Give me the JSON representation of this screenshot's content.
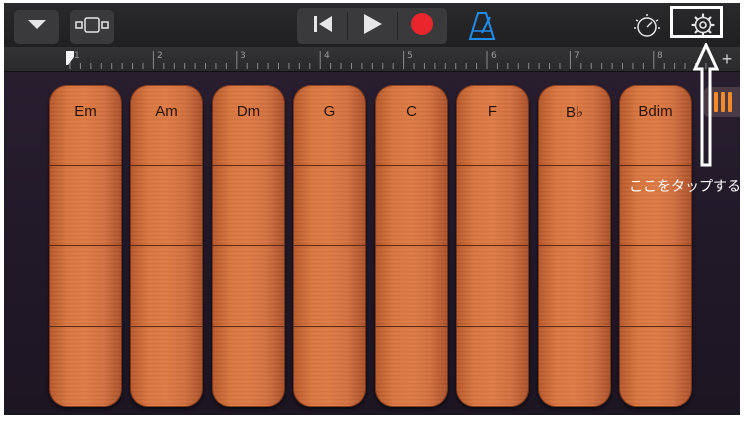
{
  "toolbar": {
    "icons": {
      "menu": "chevron-down-icon",
      "tracks": "tracks-view-icon",
      "rewind": "go-to-beginning-icon",
      "play": "play-icon",
      "record": "record-icon",
      "metronome": "metronome-icon",
      "tempo": "master-volume-icon",
      "settings": "gear-icon"
    },
    "colors": {
      "record": "#e8262b",
      "metronome": "#1e8cf0"
    }
  },
  "ruler": {
    "marks": [
      "1",
      "2",
      "3",
      "4",
      "5",
      "6",
      "7",
      "8"
    ],
    "add_label": "+"
  },
  "chord_strips": [
    {
      "label": "Em"
    },
    {
      "label": "Am"
    },
    {
      "label": "Dm"
    },
    {
      "label": "G"
    },
    {
      "label": "C"
    },
    {
      "label": "F"
    },
    {
      "label": "B♭"
    },
    {
      "label": "Bdim"
    }
  ],
  "annotation": {
    "text": "ここをタップする"
  }
}
